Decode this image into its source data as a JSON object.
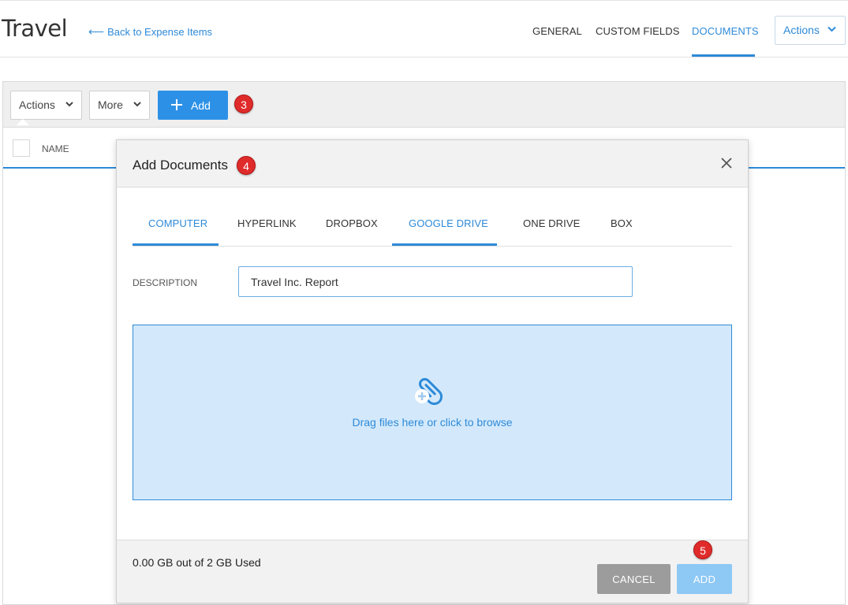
{
  "header": {
    "title": "Travel",
    "back_link": "Back to Expense Items",
    "tabs": [
      {
        "label": "GENERAL",
        "active": false
      },
      {
        "label": "CUSTOM FIELDS",
        "active": false
      },
      {
        "label": "DOCUMENTS",
        "active": true
      }
    ],
    "actions_label": "Actions"
  },
  "toolbar": {
    "actions_label": "Actions",
    "more_label": "More",
    "add_label": "Add",
    "step_badge": "3"
  },
  "table": {
    "columns": [
      "NAME"
    ]
  },
  "modal": {
    "title": "Add Documents",
    "step_badge": "4",
    "source_tabs": [
      {
        "label": "COMPUTER",
        "active": true
      },
      {
        "label": "HYPERLINK",
        "active": false
      },
      {
        "label": "DROPBOX",
        "active": false
      },
      {
        "label": "GOOGLE DRIVE",
        "active": true
      },
      {
        "label": "ONE DRIVE",
        "active": false
      },
      {
        "label": "BOX",
        "active": false
      }
    ],
    "description_label": "DESCRIPTION",
    "description_value": "Travel Inc. Report",
    "dropzone_text": "Drag files here or click to browse",
    "dropzone_icon": "paperclip-plus-icon",
    "storage_text": "0.00 GB out of 2 GB Used",
    "cancel_label": "CANCEL",
    "add_label": "ADD",
    "footer_step_badge": "5"
  },
  "colors": {
    "accent": "#2e8ad8",
    "badge": "#e02b2b",
    "dropzone_bg": "#d3e9fb"
  }
}
